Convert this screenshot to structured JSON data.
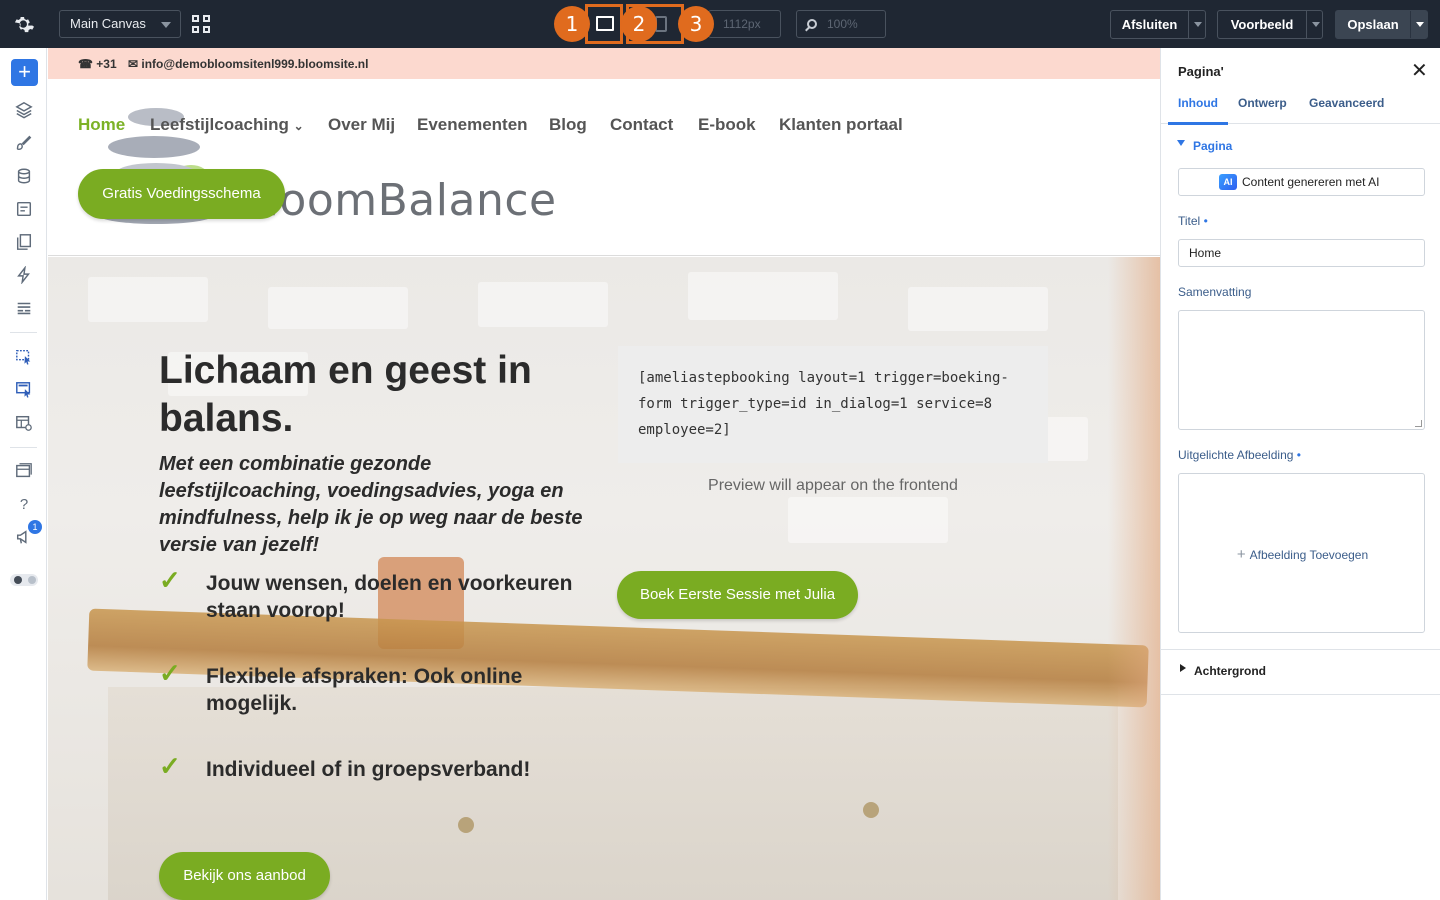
{
  "toolbar": {
    "canvas_select": "Main Canvas",
    "width_value": "1112px",
    "zoom_value": "100%",
    "markers": [
      "1",
      "2",
      "3"
    ],
    "exit_label": "Afsluiten",
    "preview_label": "Voorbeeld",
    "save_label": "Opslaan"
  },
  "site": {
    "phone": "+31",
    "email": "info@demobloomsitenl999.bloomsite.nl",
    "logo_text": "BloomBalance",
    "nav": [
      "Home",
      "Leefstijlcoaching",
      "Over Mij",
      "Evenementen",
      "Blog",
      "Contact",
      "E-book",
      "Klanten portaal"
    ],
    "cta_top": "Gratis Voedingsschema",
    "hero_title": "Lichaam en geest in balans.",
    "hero_subtitle": "Met een combinatie gezonde leefstijlcoaching, voedingsadvies, yoga en mindfulness, help ik je op weg naar de beste versie van jezelf!",
    "features": [
      "Jouw wensen, doelen en voorkeuren staan voorop!",
      "Flexibele afspraken: Ook online mogelijk.",
      "Individueel of in groepsverband!"
    ],
    "shortcode": "[ameliastepbooking layout=1 trigger=boeking-form trigger_type=id in_dialog=1 service=8 employee=2]",
    "preview_note": "Preview will appear on the frontend",
    "book_button": "Boek Eerste Sessie met Julia",
    "offer_button": "Bekijk ons aanbod"
  },
  "left_bar": {
    "notification_count": "1",
    "icons": [
      "add-icon",
      "layers-icon",
      "brush-icon",
      "database-icon",
      "form-icon",
      "pages-icon",
      "bolt-icon",
      "template-icon",
      "select-tool-icon",
      "select-multi-icon",
      "preview-layout-icon",
      "stacked-layers-icon",
      "help-icon",
      "megaphone-icon",
      "theme-toggle-icon"
    ]
  },
  "panel": {
    "title": "Pagina'",
    "tabs": [
      "Inhoud",
      "Ontwerp",
      "Geavanceerd"
    ],
    "section": "Pagina",
    "ai_button": "Content genereren met AI",
    "ai_badge": "AI",
    "title_label": "Titel",
    "title_value": "Home",
    "summary_label": "Samenvatting",
    "featured_label": "Uitgelichte Afbeelding",
    "add_image": "Afbeelding Toevoegen",
    "background_label": "Achtergrond"
  },
  "colors": {
    "accent_blue": "#2f76e4",
    "brand_green": "#7aac22",
    "toolbar_bg": "#1f2733",
    "marker_orange": "#e06b1e"
  }
}
